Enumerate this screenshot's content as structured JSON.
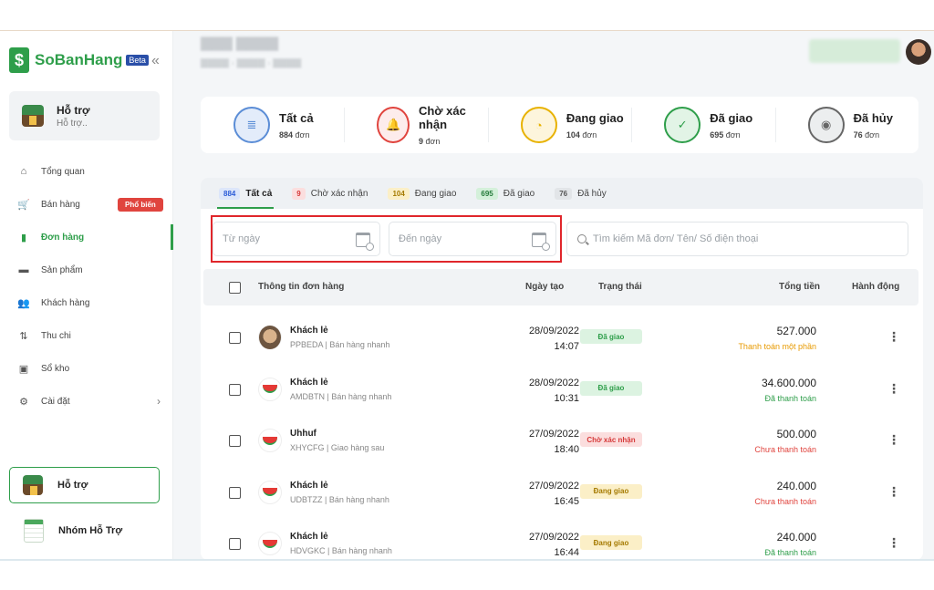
{
  "colors": {
    "brand": "#2e9e4a",
    "highlight": "#e0262b",
    "badge_red": "#e0443e"
  },
  "sidebar": {
    "logo_text": "SoBanHang",
    "beta_label": "Beta",
    "collapse_icon": "«",
    "store": {
      "name": "Hỗ trợ",
      "sub": "Hỗ trợ.."
    },
    "items": [
      {
        "label": "Tổng quan",
        "icon": "home-icon",
        "glyph": "⌂"
      },
      {
        "label": "Bán hàng",
        "icon": "cart-icon",
        "glyph": "🛒",
        "badge": "Phổ biến"
      },
      {
        "label": "Đơn hàng",
        "icon": "order-icon",
        "glyph": "▮",
        "active": true
      },
      {
        "label": "Sản phẩm",
        "icon": "product-icon",
        "glyph": "▬"
      },
      {
        "label": "Khách hàng",
        "icon": "customers-icon",
        "glyph": "👥"
      },
      {
        "label": "Thu chi",
        "icon": "transfer-icon",
        "glyph": "⇅"
      },
      {
        "label": "Sổ kho",
        "icon": "warehouse-icon",
        "glyph": "▣"
      },
      {
        "label": "Cài đặt",
        "icon": "gear-icon",
        "glyph": "⚙",
        "chevron": "›"
      }
    ],
    "help_button": "Hỗ trợ",
    "group_label": "Nhóm Hỗ Trợ"
  },
  "stats": [
    {
      "label": "Tất cả",
      "count": "884",
      "unit": "đơn",
      "icon": "list-icon",
      "glyph": "≣",
      "color": "#5b8dd6",
      "bg": "#e3ecfa"
    },
    {
      "label": "Chờ xác nhận",
      "count": "9",
      "unit": "đơn",
      "icon": "bell-icon",
      "glyph": "🔔",
      "color": "#e0443e",
      "bg": "#fdecec"
    },
    {
      "label": "Đang giao",
      "count": "104",
      "unit": "đơn",
      "icon": "clock-icon",
      "glyph": "◔",
      "color": "#e8b200",
      "bg": "#fdf5dc"
    },
    {
      "label": "Đã giao",
      "count": "695",
      "unit": "đơn",
      "icon": "check-icon",
      "glyph": "✓",
      "color": "#2e9e4a",
      "bg": "#e2f4e6"
    },
    {
      "label": "Đã hủy",
      "count": "76",
      "unit": "đơn",
      "icon": "cancel-icon",
      "glyph": "◉",
      "color": "#666666",
      "bg": "#eceeef"
    }
  ],
  "tabs": [
    {
      "count": "884",
      "label": "Tất cả",
      "color": "#2a5bd7",
      "bg": "#dce6fa",
      "active": true
    },
    {
      "count": "9",
      "label": "Chờ xác nhận",
      "color": "#d63a3a",
      "bg": "#fbdede"
    },
    {
      "count": "104",
      "label": "Đang giao",
      "color": "#a57a00",
      "bg": "#fbefc7"
    },
    {
      "count": "695",
      "label": "Đã giao",
      "color": "#247a3a",
      "bg": "#d4f0da"
    },
    {
      "count": "76",
      "label": "Đã hủy",
      "color": "#555555",
      "bg": "#e2e5e8"
    }
  ],
  "filters": {
    "from_placeholder": "Từ ngày",
    "to_placeholder": "Đến ngày",
    "search_placeholder": "Tìm kiếm Mã đơn/ Tên/ Số điện thoại"
  },
  "table": {
    "headers": {
      "info": "Thông tin đơn hàng",
      "date": "Ngày tạo",
      "status": "Trạng thái",
      "total": "Tổng tiền",
      "action": "Hành động"
    },
    "rows": [
      {
        "avatar": "photo",
        "name": "Khách lẻ",
        "meta": "PPBEDA | Bán hàng nhanh",
        "date": "28/09/2022",
        "time": "14:07",
        "status": "Đã giao",
        "status_fg": "#2e9e4a",
        "status_bg": "#dcf3e1",
        "amount": "527.000",
        "payment": "Thanh toán một phần",
        "payment_color": "#e89a00"
      },
      {
        "avatar": "melon",
        "name": "Khách lẻ",
        "meta": "AMDBTN | Bán hàng nhanh",
        "date": "28/09/2022",
        "time": "10:31",
        "status": "Đã giao",
        "status_fg": "#2e9e4a",
        "status_bg": "#dcf3e1",
        "amount": "34.600.000",
        "payment": "Đã thanh toán",
        "payment_color": "#2e9e4a"
      },
      {
        "avatar": "melon",
        "name": "Uhhuf",
        "meta": "XHYCFG | Giao hàng sau",
        "date": "27/09/2022",
        "time": "18:40",
        "status": "Chờ xác nhận",
        "status_fg": "#d63a3a",
        "status_bg": "#fbdede",
        "amount": "500.000",
        "payment": "Chưa thanh toán",
        "payment_color": "#e0443e"
      },
      {
        "avatar": "melon",
        "name": "Khách lẻ",
        "meta": "UDBTZZ | Bán hàng nhanh",
        "date": "27/09/2022",
        "time": "16:45",
        "status": "Đang giao",
        "status_fg": "#a57a00",
        "status_bg": "#fbefc7",
        "amount": "240.000",
        "payment": "Chưa thanh toán",
        "payment_color": "#e0443e"
      },
      {
        "avatar": "melon",
        "name": "Khách lẻ",
        "meta": "HDVGKC | Bán hàng nhanh",
        "date": "27/09/2022",
        "time": "16:44",
        "status": "Đang giao",
        "status_fg": "#a57a00",
        "status_bg": "#fbefc7",
        "amount": "240.000",
        "payment": "Đã thanh toán",
        "payment_color": "#2e9e4a"
      }
    ]
  }
}
